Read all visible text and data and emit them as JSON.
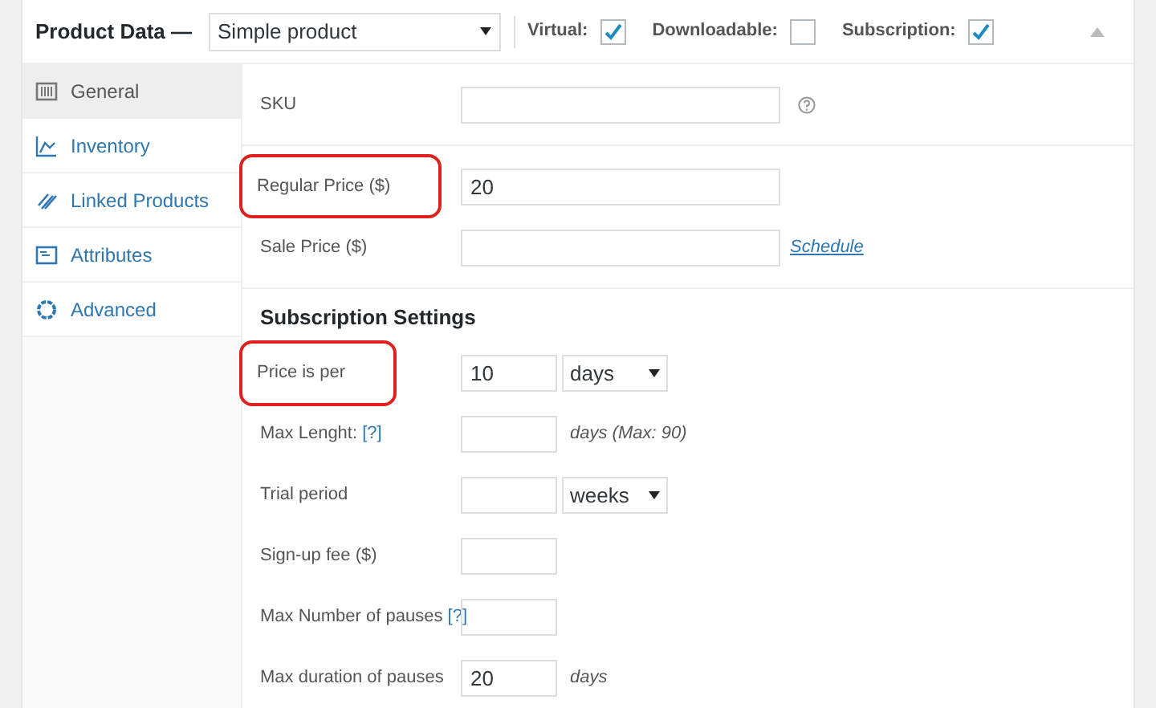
{
  "header": {
    "title": "Product Data —",
    "product_type": "Simple product",
    "options": [
      {
        "label": "Virtual:",
        "checked": true
      },
      {
        "label": "Downloadable:",
        "checked": false
      },
      {
        "label": "Subscription:",
        "checked": true
      }
    ]
  },
  "tabs": [
    {
      "label": "General",
      "selected": true
    },
    {
      "label": "Inventory",
      "selected": false
    },
    {
      "label": "Linked Products",
      "selected": false
    },
    {
      "label": "Attributes",
      "selected": false
    },
    {
      "label": "Advanced",
      "selected": false
    }
  ],
  "sections": [
    {
      "fields": [
        {
          "label": "SKU",
          "highlighted": false,
          "inputs": [
            {
              "kind": "wide"
            },
            {
              "kind": "help"
            }
          ]
        }
      ]
    },
    {
      "fields": [
        {
          "label": "Regular Price ($)",
          "highlighted": true,
          "inputs": [
            {
              "kind": "wide",
              "value": "20"
            }
          ]
        },
        {
          "label": "Sale Price ($)",
          "highlighted": false,
          "inputs": [
            {
              "kind": "wide"
            }
          ],
          "link": "Schedule"
        }
      ]
    },
    {
      "heading": "Subscription Settings",
      "fields": [
        {
          "label": "Price is per",
          "highlighted": true,
          "inputs": [
            {
              "kind": "small",
              "value": "10"
            },
            {
              "kind": "select",
              "value": "days"
            }
          ]
        },
        {
          "label": "Max Lenght:",
          "help_link": "[?]",
          "highlighted": false,
          "inputs": [
            {
              "kind": "small"
            }
          ],
          "note": "days (Max: 90)"
        },
        {
          "label": "Trial period",
          "highlighted": false,
          "inputs": [
            {
              "kind": "small"
            },
            {
              "kind": "select",
              "value": "weeks"
            }
          ]
        },
        {
          "label": "Sign-up fee ($)",
          "highlighted": false,
          "inputs": [
            {
              "kind": "small"
            }
          ]
        },
        {
          "label": "Max Number of pauses",
          "help_link": "[?]",
          "highlighted": false,
          "inputs": [
            {
              "kind": "small"
            }
          ]
        },
        {
          "label": "Max duration of pauses",
          "highlighted": false,
          "inputs": [
            {
              "kind": "small",
              "value": "20"
            }
          ],
          "note": "days"
        }
      ]
    }
  ]
}
